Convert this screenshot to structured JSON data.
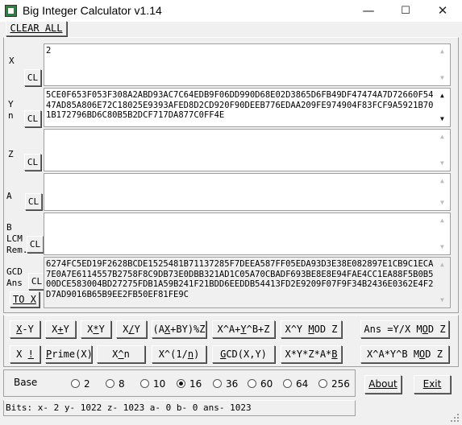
{
  "window": {
    "title": "Big Integer Calculator v1.14",
    "minimize": "—",
    "maximize": "☐",
    "close": "✕"
  },
  "toolbar": {
    "clear_all": "CLEAR ALL"
  },
  "fields": {
    "x": {
      "label": "X",
      "value": "2"
    },
    "yn": {
      "label1": "Y",
      "label2": "n",
      "value": "5CE0F653F053F308A2ABD93AC7C64EDB9F06DD990D68E02D3865D6FB49DF47474A7D72660F5447AD85A806E72C18025E9393AFED8D2CD920F90DEEB776EDAA209FE974904F83FCF9A5921B701B172796BD6C80B5B2DCF717DA877C0FF4E"
    },
    "z": {
      "label": "Z",
      "value": ""
    },
    "a": {
      "label": "A",
      "value": ""
    },
    "b": {
      "label1": "B",
      "label2": "LCM",
      "label3": "Rem.",
      "value": ""
    },
    "ans": {
      "label1": "GCD",
      "label2": "Ans",
      "value": "6274FC5ED19F2628BCDE1525481B71137285F7DEEA587FF05EDA93D3E38E082897E1CB9C1ECA7E0A7E6114557B2758F8C9DB73E0DBB321AD1C05A70CBADF693BE8E8E94FAE4CC1EA88F5B0B500DCE583004BD27275FDB1A59B241F21BDD6EEDDB54413FD2E9209F07F9F34B2436E0362E4F2D7AD9016B65B9EE2FB50EF81FE9C"
    },
    "cl": "CL",
    "to_x": "TO X"
  },
  "ops": {
    "row1": [
      {
        "u": "X",
        "rest": "-Y",
        "pre": ""
      },
      {
        "pre": "X",
        "u": "+",
        "rest": "Y"
      },
      {
        "pre": "X",
        "u": "*",
        "rest": "Y"
      },
      {
        "pre": "X",
        "u": "/",
        "rest": "Y"
      },
      {
        "pre": "(A",
        "u": "X",
        "rest": "+BY)%Z"
      },
      {
        "pre": "X^A+",
        "u": "Y",
        "rest": "^B+Z"
      },
      {
        "pre": "X^Y ",
        "u": "M",
        "rest": "OD Z"
      },
      {
        "pre": "Ans =Y/X M",
        "u": "O",
        "rest": "D Z"
      }
    ],
    "row2": [
      {
        "pre": "X ",
        "u": "!",
        "rest": ""
      },
      {
        "pre": "",
        "u": "P",
        "rest": "rime(X)"
      },
      {
        "pre": "X",
        "u": "^",
        "rest": "n"
      },
      {
        "pre": "X^(1/",
        "u": "n",
        "rest": ")"
      },
      {
        "pre": "",
        "u": "G",
        "rest": "CD(X,Y)"
      },
      {
        "pre": "X*Y*Z*A*",
        "u": "B",
        "rest": ""
      },
      {
        "pre": "X^A*Y^B M",
        "u": "O",
        "rest": "D Z"
      }
    ]
  },
  "base": {
    "label": "Base",
    "options": [
      "2",
      "8",
      "10",
      "16",
      "36",
      "60",
      "64",
      "256"
    ],
    "selected": "16"
  },
  "buttons": {
    "about": "About",
    "exit": "Exit"
  },
  "status": "Bits: x- 2 y- 1022 z- 1023 a- 0 b- 0 ans- 1023"
}
